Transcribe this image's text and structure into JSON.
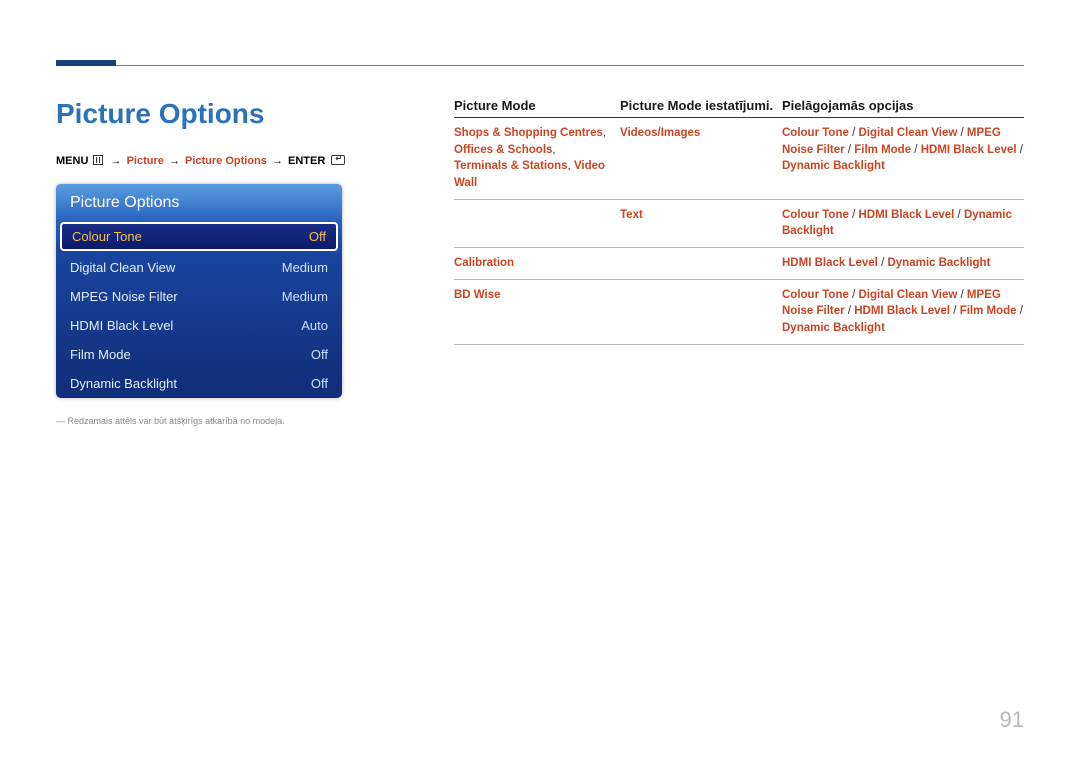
{
  "page": {
    "title": "Picture Options",
    "number": "91",
    "note": "Redzamais attēls var būt atšķirīgs atkarībā no modeļa."
  },
  "breadcrumb": {
    "menu": "MENU",
    "p1": "Picture",
    "p2": "Picture Options",
    "enter": "ENTER"
  },
  "menu": {
    "title": "Picture Options",
    "items": [
      {
        "label": "Colour Tone",
        "value": "Off",
        "selected": true
      },
      {
        "label": "Digital Clean View",
        "value": "Medium",
        "selected": false
      },
      {
        "label": "MPEG Noise Filter",
        "value": "Medium",
        "selected": false
      },
      {
        "label": "HDMI Black Level",
        "value": "Auto",
        "selected": false
      },
      {
        "label": "Film Mode",
        "value": "Off",
        "selected": false
      },
      {
        "label": "Dynamic Backlight",
        "value": "Off",
        "selected": false
      }
    ]
  },
  "table": {
    "headers": {
      "h1": "Picture Mode",
      "h2": "Picture Mode iestatījumi.",
      "h3": "Pielāgojamās opcijas"
    },
    "rows": [
      {
        "c1_segments": [
          {
            "t": "Shops & Shopping Centres",
            "c": true
          },
          {
            "t": ", ",
            "c": false
          },
          {
            "t": "Offices & Schools",
            "c": true
          },
          {
            "t": ", ",
            "c": false
          },
          {
            "t": "Terminals & Stations",
            "c": true
          },
          {
            "t": ", ",
            "c": false
          },
          {
            "t": "Video Wall",
            "c": true
          }
        ],
        "c2_segments": [
          {
            "t": "Videos/Images",
            "c": true
          }
        ],
        "c3_segments": [
          {
            "t": "Colour Tone",
            "c": true
          },
          {
            "t": " / ",
            "c": false
          },
          {
            "t": "Digital Clean View",
            "c": true
          },
          {
            "t": " / ",
            "c": false
          },
          {
            "t": "MPEG Noise Filter",
            "c": true
          },
          {
            "t": " / ",
            "c": false
          },
          {
            "t": "Film Mode",
            "c": true
          },
          {
            "t": " / ",
            "c": false
          },
          {
            "t": "HDMI Black Level",
            "c": true
          },
          {
            "t": " / ",
            "c": false
          },
          {
            "t": "Dynamic Backlight",
            "c": true
          }
        ]
      },
      {
        "c1_segments": [],
        "c2_segments": [
          {
            "t": "Text",
            "c": true
          }
        ],
        "c3_segments": [
          {
            "t": "Colour Tone",
            "c": true
          },
          {
            "t": " / ",
            "c": false
          },
          {
            "t": "HDMI Black Level",
            "c": true
          },
          {
            "t": " / ",
            "c": false
          },
          {
            "t": "Dynamic Backlight",
            "c": true
          }
        ]
      },
      {
        "c1_segments": [
          {
            "t": "Calibration",
            "c": true
          }
        ],
        "c2_segments": [],
        "c3_segments": [
          {
            "t": "HDMI Black Level",
            "c": true
          },
          {
            "t": " / ",
            "c": false
          },
          {
            "t": "Dynamic Backlight",
            "c": true
          }
        ]
      },
      {
        "c1_segments": [
          {
            "t": "BD Wise",
            "c": true
          }
        ],
        "c2_segments": [],
        "c3_segments": [
          {
            "t": "Colour Tone",
            "c": true
          },
          {
            "t": " / ",
            "c": false
          },
          {
            "t": "Digital Clean View",
            "c": true
          },
          {
            "t": " / ",
            "c": false
          },
          {
            "t": "MPEG Noise Filter",
            "c": true
          },
          {
            "t": " / ",
            "c": false
          },
          {
            "t": "HDMI Black Level",
            "c": true
          },
          {
            "t": " / ",
            "c": false
          },
          {
            "t": "Film Mode",
            "c": true
          },
          {
            "t": " / ",
            "c": false
          },
          {
            "t": "Dynamic Backlight",
            "c": true
          }
        ]
      }
    ]
  }
}
